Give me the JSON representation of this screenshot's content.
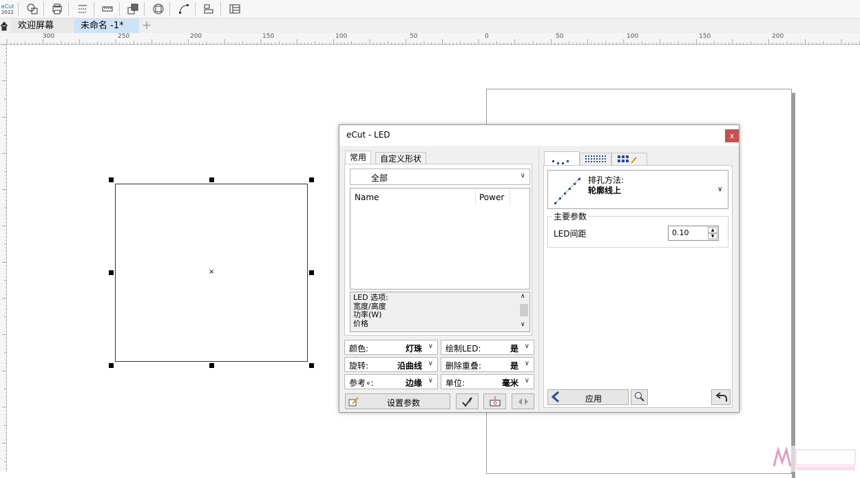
{
  "toolbar": {
    "logo_text": "eCut",
    "logo_year": "2022",
    "icons": [
      "ecut-logo-icon",
      "shapes-icon",
      "print-icon",
      "cut-icon",
      "ruler-icon",
      "arrange-icon",
      "weld-icon",
      "curve-icon",
      "align-icon",
      "panel-icon"
    ]
  },
  "tabs": [
    {
      "label": "欢迎屏幕"
    },
    {
      "label": "未命名 -1*"
    }
  ],
  "ruler": {
    "labels": [
      "300",
      "250",
      "200",
      "150",
      "100",
      "50",
      "0",
      "50",
      "100",
      "150",
      "200"
    ]
  },
  "dialog": {
    "title": "eCut - LED",
    "close": "x",
    "left_tabs": [
      "常用",
      "自定义形状"
    ],
    "filter_value": "全部",
    "list_headers": [
      "Name",
      "Power"
    ],
    "led_options": [
      "LED 选项:",
      "宽度/高度",
      "功率(W)",
      "价格"
    ],
    "fields": [
      {
        "label": "颜色:",
        "value": "灯珠"
      },
      {
        "label": "绘制LED:",
        "value": "是"
      },
      {
        "label": "旋转:",
        "value": "沿曲线"
      },
      {
        "label": "删除重叠:",
        "value": "是"
      },
      {
        "label": "参考∘:",
        "value": "边缘"
      },
      {
        "label": "单位:",
        "value": "毫米"
      }
    ],
    "set_params": "设置参数",
    "method_label": "排孔方法:",
    "method_value": "轮廓线上",
    "main_params": "主要参数",
    "led_spacing_label": "LED间距",
    "led_spacing_value": "0.10",
    "apply": "应用"
  },
  "colors": {
    "accent_tab": "#cfe3f7",
    "close_red": "#c75050",
    "arrow_blue": "#2a4a8a"
  }
}
